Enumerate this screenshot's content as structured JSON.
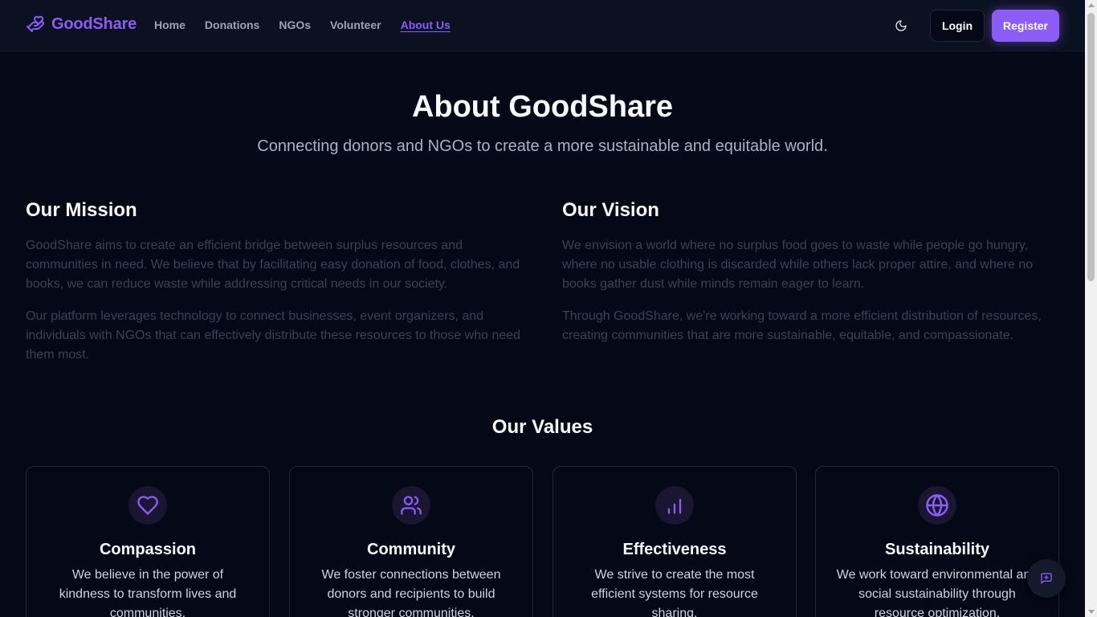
{
  "brand": {
    "name": "GoodShare",
    "icon": "hand-heart-icon",
    "color": "#8b5cf6"
  },
  "nav": {
    "items": [
      {
        "label": "Home"
      },
      {
        "label": "Donations"
      },
      {
        "label": "NGOs"
      },
      {
        "label": "Volunteer"
      },
      {
        "label": "About Us",
        "active": true
      }
    ]
  },
  "header": {
    "theme_icon": "moon-icon",
    "login_label": "Login",
    "register_label": "Register"
  },
  "hero": {
    "title": "About GoodShare",
    "subtitle": "Connecting donors and NGOs to create a more sustainable and equitable world."
  },
  "mission": {
    "title": "Our Mission",
    "paragraphs": [
      "GoodShare aims to create an efficient bridge between surplus resources and communities in need. We believe that by facilitating easy donation of food, clothes, and books, we can reduce waste while addressing critical needs in our society.",
      "Our platform leverages technology to connect businesses, event organizers, and individuals with NGOs that can effectively distribute these resources to those who need them most."
    ]
  },
  "vision": {
    "title": "Our Vision",
    "paragraphs": [
      "We envision a world where no surplus food goes to waste while people go hungry, where no usable clothing is discarded while others lack proper attire, and where no books gather dust while minds remain eager to learn.",
      "Through GoodShare, we're working toward a more efficient distribution of resources, creating communities that are more sustainable, equitable, and compassionate."
    ]
  },
  "values": {
    "title": "Our Values",
    "cards": [
      {
        "icon": "heart-icon",
        "title": "Compassion",
        "text": "We believe in the power of kindness to transform lives and communities."
      },
      {
        "icon": "users-icon",
        "title": "Community",
        "text": "We foster connections between donors and recipients to build stronger communities."
      },
      {
        "icon": "bar-chart-icon",
        "title": "Effectiveness",
        "text": "We strive to create the most efficient systems for resource sharing."
      },
      {
        "icon": "globe-icon",
        "title": "Sustainability",
        "text": "We work toward environmental and social sustainability through resource optimization."
      }
    ]
  },
  "chat": {
    "icon": "message-plus-icon"
  },
  "colors": {
    "background": "#050816",
    "header": "#0b1120",
    "accent": "#8b5cf6",
    "muted_text": "#3a4255"
  }
}
